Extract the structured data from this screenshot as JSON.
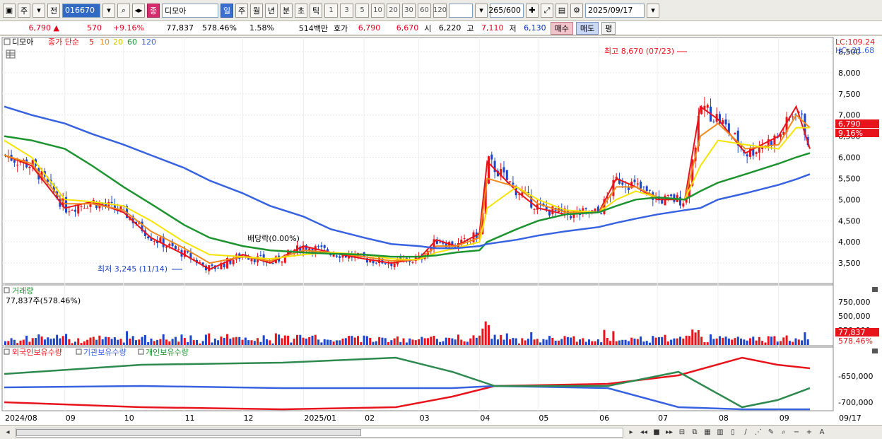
{
  "toolbar": {
    "chart_type": "주",
    "range_mode": "전",
    "stock_code": "016670",
    "stock_name": "디모아",
    "stock_badge": "종",
    "periods": [
      "일",
      "주",
      "월",
      "년",
      "분",
      "초",
      "틱"
    ],
    "active_period": "일",
    "intervals": [
      "1",
      "3",
      "5",
      "10",
      "20",
      "30",
      "60",
      "120"
    ],
    "count": "265/600",
    "date": "2025/09/17"
  },
  "infobar": {
    "price": "6,790",
    "change": "570",
    "change_pct": "+9.16%",
    "volume": "77,837",
    "volume_ratio": "578.46%",
    "turnover": "1.58%",
    "amount": "514백만",
    "quote_label": "호가",
    "ask": "6,790",
    "bid": "6,670",
    "open_label": "시",
    "open": "6,220",
    "high_label": "고",
    "high": "7,110",
    "low_label": "저",
    "low": "6,130",
    "buy_label": "매수",
    "sell_label": "매도",
    "eval_label": "평"
  },
  "price_panel": {
    "legend_name": "디모아",
    "legend_indicator": "종가 단순",
    "ma_periods": [
      "5",
      "10",
      "20",
      "60",
      "120"
    ],
    "lc_label": "LC:109.24",
    "hc_label": "HC:-21.68",
    "high_annotation": "최고 8,670 (07/23)",
    "low_annotation": "최저 3,245 (11/14)",
    "dividend_annotation": "배당락(0.00%)",
    "current_price_tag": "6,790",
    "current_pct_tag": "9.16%",
    "y_ticks": [
      "8,500",
      "8,000",
      "7,500",
      "7,000",
      "6,500",
      "6,000",
      "5,500",
      "5,000",
      "4,500",
      "4,000",
      "3,500"
    ]
  },
  "volume_panel": {
    "title": "거래량",
    "value_label": "77,837주(578.46%)",
    "y_ticks": [
      "750,000",
      "500,000",
      "250,000"
    ],
    "current_tag": "77,837",
    "current_pct_tag": "578.46%"
  },
  "holding_panel": {
    "legend": [
      "외국인보유수량",
      "기관보유수량",
      "개인보유수량"
    ],
    "y_ticks": [
      "-650,000",
      "-700,000"
    ]
  },
  "x_axis": {
    "labels": [
      "2024/08",
      "09",
      "10",
      "11",
      "12",
      "2025/01",
      "02",
      "03",
      "04",
      "05",
      "06",
      "07",
      "08",
      "09"
    ],
    "right_label": "09/17"
  },
  "colors": {
    "ma5": "#e8141c",
    "ma10": "#f08a1c",
    "ma20": "#f5e400",
    "ma60": "#1e9430",
    "ma120": "#3762e0",
    "up": "#e8141c",
    "down": "#1e46c8"
  },
  "chart_data": {
    "type": "line",
    "x": [
      "2024-08-01",
      "2024-08-15",
      "2024-09-01",
      "2024-09-15",
      "2024-10-01",
      "2024-10-15",
      "2024-11-01",
      "2024-11-14",
      "2024-12-01",
      "2024-12-15",
      "2025-01-01",
      "2025-01-15",
      "2025-02-01",
      "2025-02-15",
      "2025-03-01",
      "2025-03-10",
      "2025-03-20",
      "2025-04-01",
      "2025-04-05",
      "2025-04-20",
      "2025-05-01",
      "2025-05-15",
      "2025-06-01",
      "2025-06-10",
      "2025-06-20",
      "2025-07-01",
      "2025-07-15",
      "2025-07-23",
      "2025-08-01",
      "2025-08-15",
      "2025-09-01",
      "2025-09-10",
      "2025-09-17"
    ],
    "series": [
      {
        "name": "5",
        "values": [
          6050,
          5800,
          4800,
          4950,
          4700,
          4100,
          3700,
          3350,
          3700,
          3500,
          3900,
          3750,
          3600,
          3500,
          3600,
          4050,
          3900,
          4200,
          5900,
          5200,
          4800,
          4650,
          4700,
          5500,
          5300,
          5000,
          5000,
          7200,
          6900,
          6100,
          6500,
          7200,
          6200
        ]
      },
      {
        "name": "10",
        "values": [
          6050,
          5850,
          4900,
          4900,
          4750,
          4250,
          3850,
          3500,
          3650,
          3550,
          3800,
          3750,
          3650,
          3550,
          3580,
          3900,
          3900,
          4100,
          5500,
          5300,
          4900,
          4700,
          4700,
          5300,
          5300,
          5050,
          5000,
          6500,
          6800,
          6200,
          6300,
          7000,
          6700
        ]
      },
      {
        "name": "20",
        "values": [
          6400,
          6000,
          5000,
          4950,
          4850,
          4500,
          4000,
          3700,
          3650,
          3600,
          3700,
          3750,
          3700,
          3600,
          3580,
          3750,
          3850,
          4000,
          4800,
          5300,
          5000,
          4750,
          4700,
          5000,
          5200,
          5050,
          5000,
          5800,
          6400,
          6300,
          6200,
          6700,
          6700
        ]
      },
      {
        "name": "60",
        "values": [
          6500,
          6400,
          6200,
          5800,
          5300,
          4900,
          4400,
          4100,
          3900,
          3800,
          3750,
          3720,
          3700,
          3650,
          3650,
          3680,
          3750,
          3800,
          4000,
          4300,
          4500,
          4650,
          4700,
          4850,
          5000,
          5050,
          5000,
          5200,
          5400,
          5600,
          5850,
          6000,
          6100
        ]
      },
      {
        "name": "120",
        "values": [
          7200,
          7000,
          6800,
          6550,
          6300,
          6050,
          5750,
          5450,
          5150,
          4850,
          4600,
          4300,
          4100,
          3950,
          3900,
          3850,
          3850,
          3900,
          3950,
          4050,
          4150,
          4250,
          4350,
          4450,
          4550,
          4650,
          4750,
          4800,
          5000,
          5150,
          5350,
          5480,
          5600
        ]
      }
    ],
    "ylim": [
      3100,
      8700
    ],
    "high": {
      "value": 8670,
      "date": "07/23"
    },
    "low": {
      "value": 3245,
      "date": "11/14"
    }
  }
}
